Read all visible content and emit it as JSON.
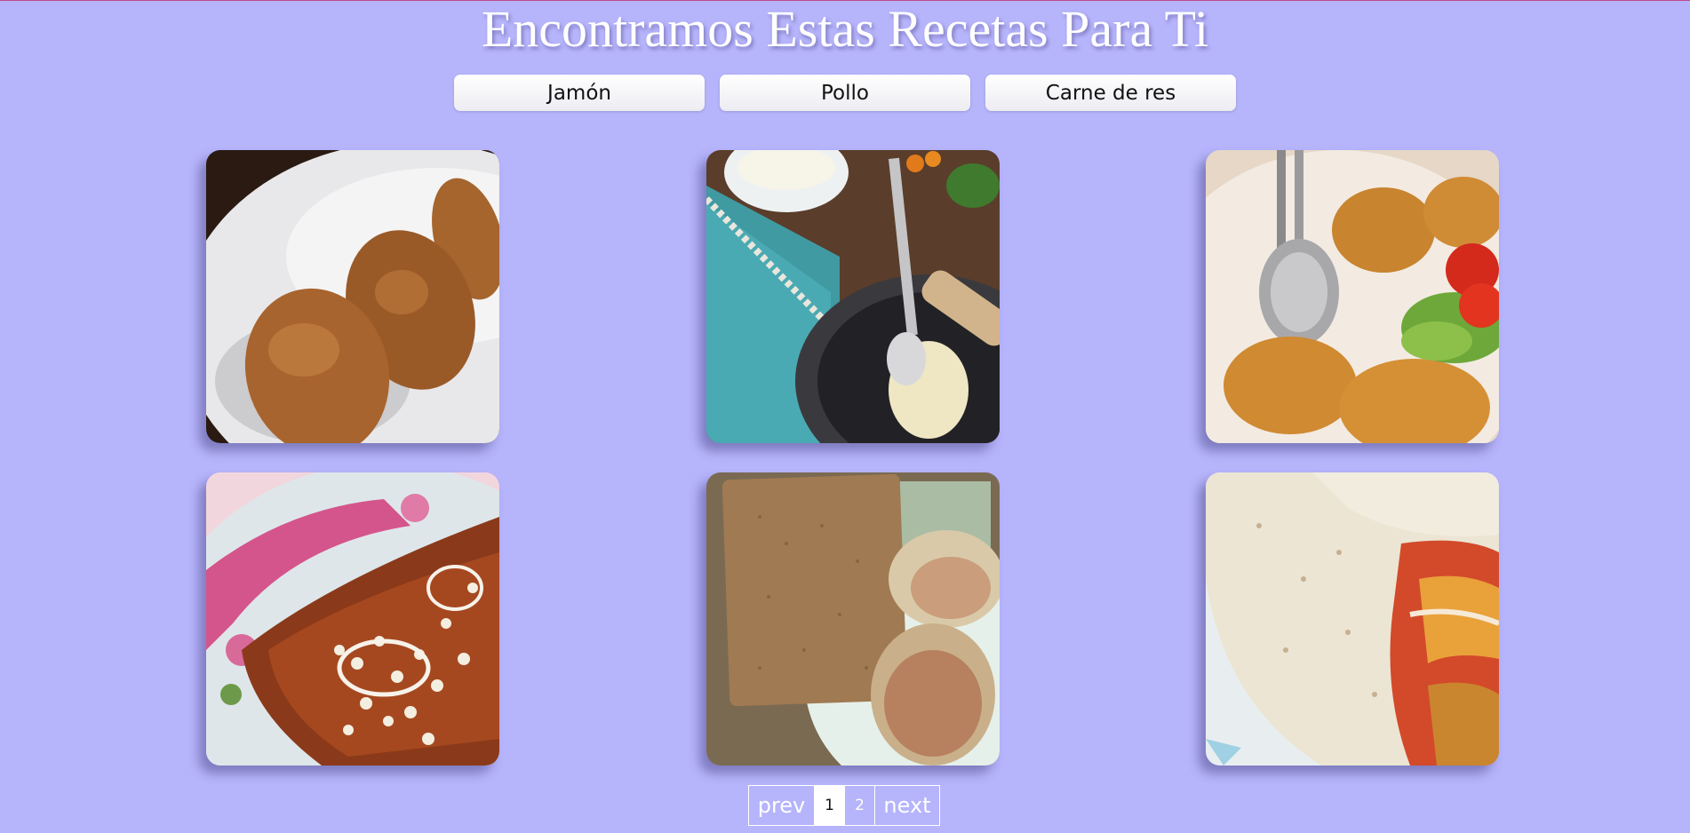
{
  "page": {
    "title": "Encontramos Estas Recetas Para Ti",
    "background_color": "#b6b4fb"
  },
  "filters": [
    {
      "label": "Jamón"
    },
    {
      "label": "Pollo"
    },
    {
      "label": "Carne de res"
    }
  ],
  "recipes": [
    {
      "image": "croquettes-on-white-plate"
    },
    {
      "image": "croquettes-with-mayonnaise-and-spoon"
    },
    {
      "image": "croquettes-with-tomato-salad"
    },
    {
      "image": "enchiladas-with-cheese-and-onion"
    },
    {
      "image": "crispbread-and-cabbage-rolls"
    },
    {
      "image": "tortilla-wrap"
    }
  ],
  "pagination": {
    "prev_label": "prev",
    "pages": [
      "1",
      "2"
    ],
    "current_page": "1",
    "next_label": "next"
  }
}
